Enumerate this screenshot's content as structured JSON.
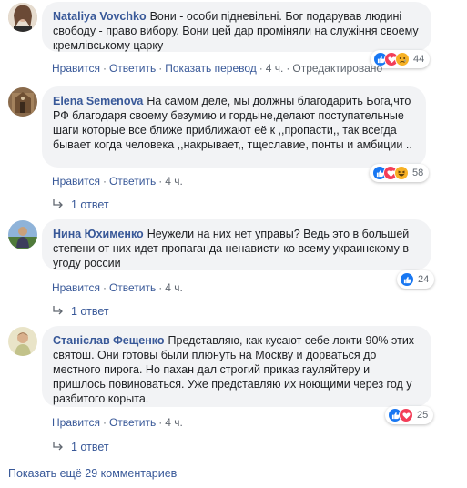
{
  "comments": [
    {
      "author": "Nataliya Vovchko",
      "text": "Вони - особи підневільні. Бог подарував людині свободу - право вибору. Вони цей дар проміняли на служіння своему кремлівському царку",
      "actions": {
        "like": "Нравится",
        "reply": "Ответить",
        "translate": "Показать перевод",
        "time": "4 ч.",
        "edited": "Отредактировано"
      },
      "reactions": {
        "icons": [
          "like-icon",
          "love-icon",
          "sad-icon"
        ],
        "count": "44"
      }
    },
    {
      "author": "Elena Semenova",
      "text": "На самом деле, мы должны благодарить Бога,что РФ благодаря своему безумию и гордыне,делают поступательные шаги которые все ближе приближают её к ,,пропасти,, так всегда бывает когда человека ,,накрывает,, тщеславие, понты и амбиции ..",
      "actions": {
        "like": "Нравится",
        "reply": "Ответить",
        "time": "4 ч."
      },
      "reactions": {
        "icons": [
          "like-icon",
          "love-icon",
          "haha-icon"
        ],
        "count": "58"
      },
      "replies": "1 ответ"
    },
    {
      "author": "Нина Юхименко",
      "text": "Неужели на них нет управы? Ведь это в большей степени от них идет пропаганда ненависти ко всему украинскому в угоду россии",
      "actions": {
        "like": "Нравится",
        "reply": "Ответить",
        "time": "4 ч."
      },
      "reactions": {
        "icons": [
          "like-icon"
        ],
        "count": "24"
      },
      "replies": "1 ответ"
    },
    {
      "author": "Станіслав Фещенко",
      "text": "Представляю, как кусают себе локти 90% этих святош. Они готовы были плюнуть на Москву и дорваться до местного пирога. Но пахан дал строгий приказ гауляйтеру и пришлось повиноваться. Уже представляю их ноющими через год у разбитого корыта.",
      "actions": {
        "like": "Нравится",
        "reply": "Ответить",
        "time": "4 ч."
      },
      "reactions": {
        "icons": [
          "like-icon",
          "love-icon"
        ],
        "count": "25"
      },
      "replies": "1 ответ"
    }
  ],
  "more_comments": "Показать ещё 29 комментариев",
  "colors": {
    "link": "#385898",
    "bubble": "#f2f3f5",
    "like": "#1877f2",
    "love": "#f33e58",
    "emoji": "#f7b125"
  }
}
